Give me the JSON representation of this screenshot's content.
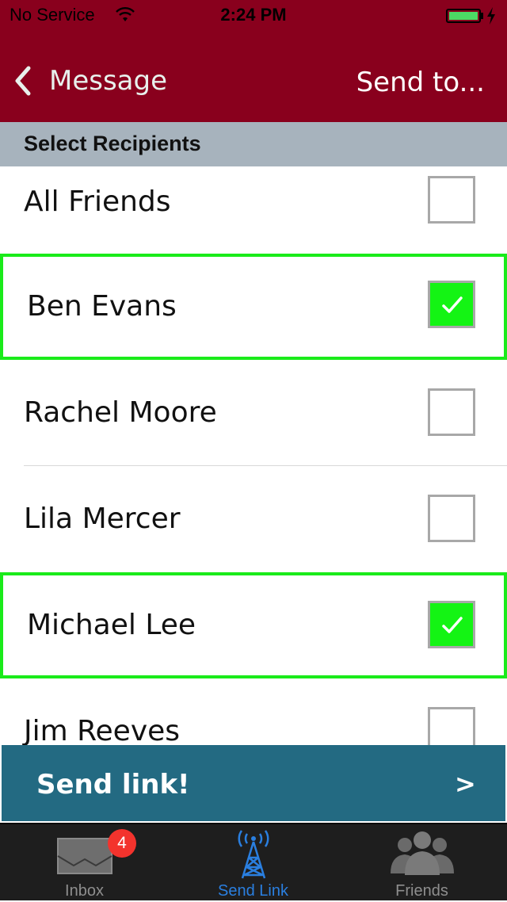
{
  "status_bar": {
    "carrier": "No Service",
    "time": "2:24 PM",
    "icons": [
      "wifi-icon",
      "battery-icon",
      "charging-bolt-icon"
    ]
  },
  "nav": {
    "back_label": "Message",
    "back_icon": "chevron-left-icon",
    "right_label": "Send to..."
  },
  "section": {
    "title": "Select Recipients"
  },
  "recipients": [
    {
      "name": "All Friends",
      "checked": false
    },
    {
      "name": "Ben Evans",
      "checked": true
    },
    {
      "name": "Rachel Moore",
      "checked": false
    },
    {
      "name": "Lila Mercer",
      "checked": false
    },
    {
      "name": "Michael Lee",
      "checked": true
    },
    {
      "name": "Jim Reeves",
      "checked": false
    }
  ],
  "send_bar": {
    "label": "Send link!",
    "chevron": ">"
  },
  "tabs": [
    {
      "label": "Inbox",
      "icon": "envelope-icon",
      "badge": "4",
      "active": false
    },
    {
      "label": "Send Link",
      "icon": "broadcast-tower-icon",
      "active": true
    },
    {
      "label": "Friends",
      "icon": "people-group-icon",
      "active": false
    }
  ],
  "colors": {
    "nav_background": "#89001d",
    "section_header": "#a7b3bd",
    "selected_highlight": "#1aeb1a",
    "checkbox_checked": "#14f414",
    "send_bar": "#236a82",
    "tab_bar": "#1e1e1e",
    "tab_active": "#2a7fe0",
    "badge": "#f3332d"
  }
}
